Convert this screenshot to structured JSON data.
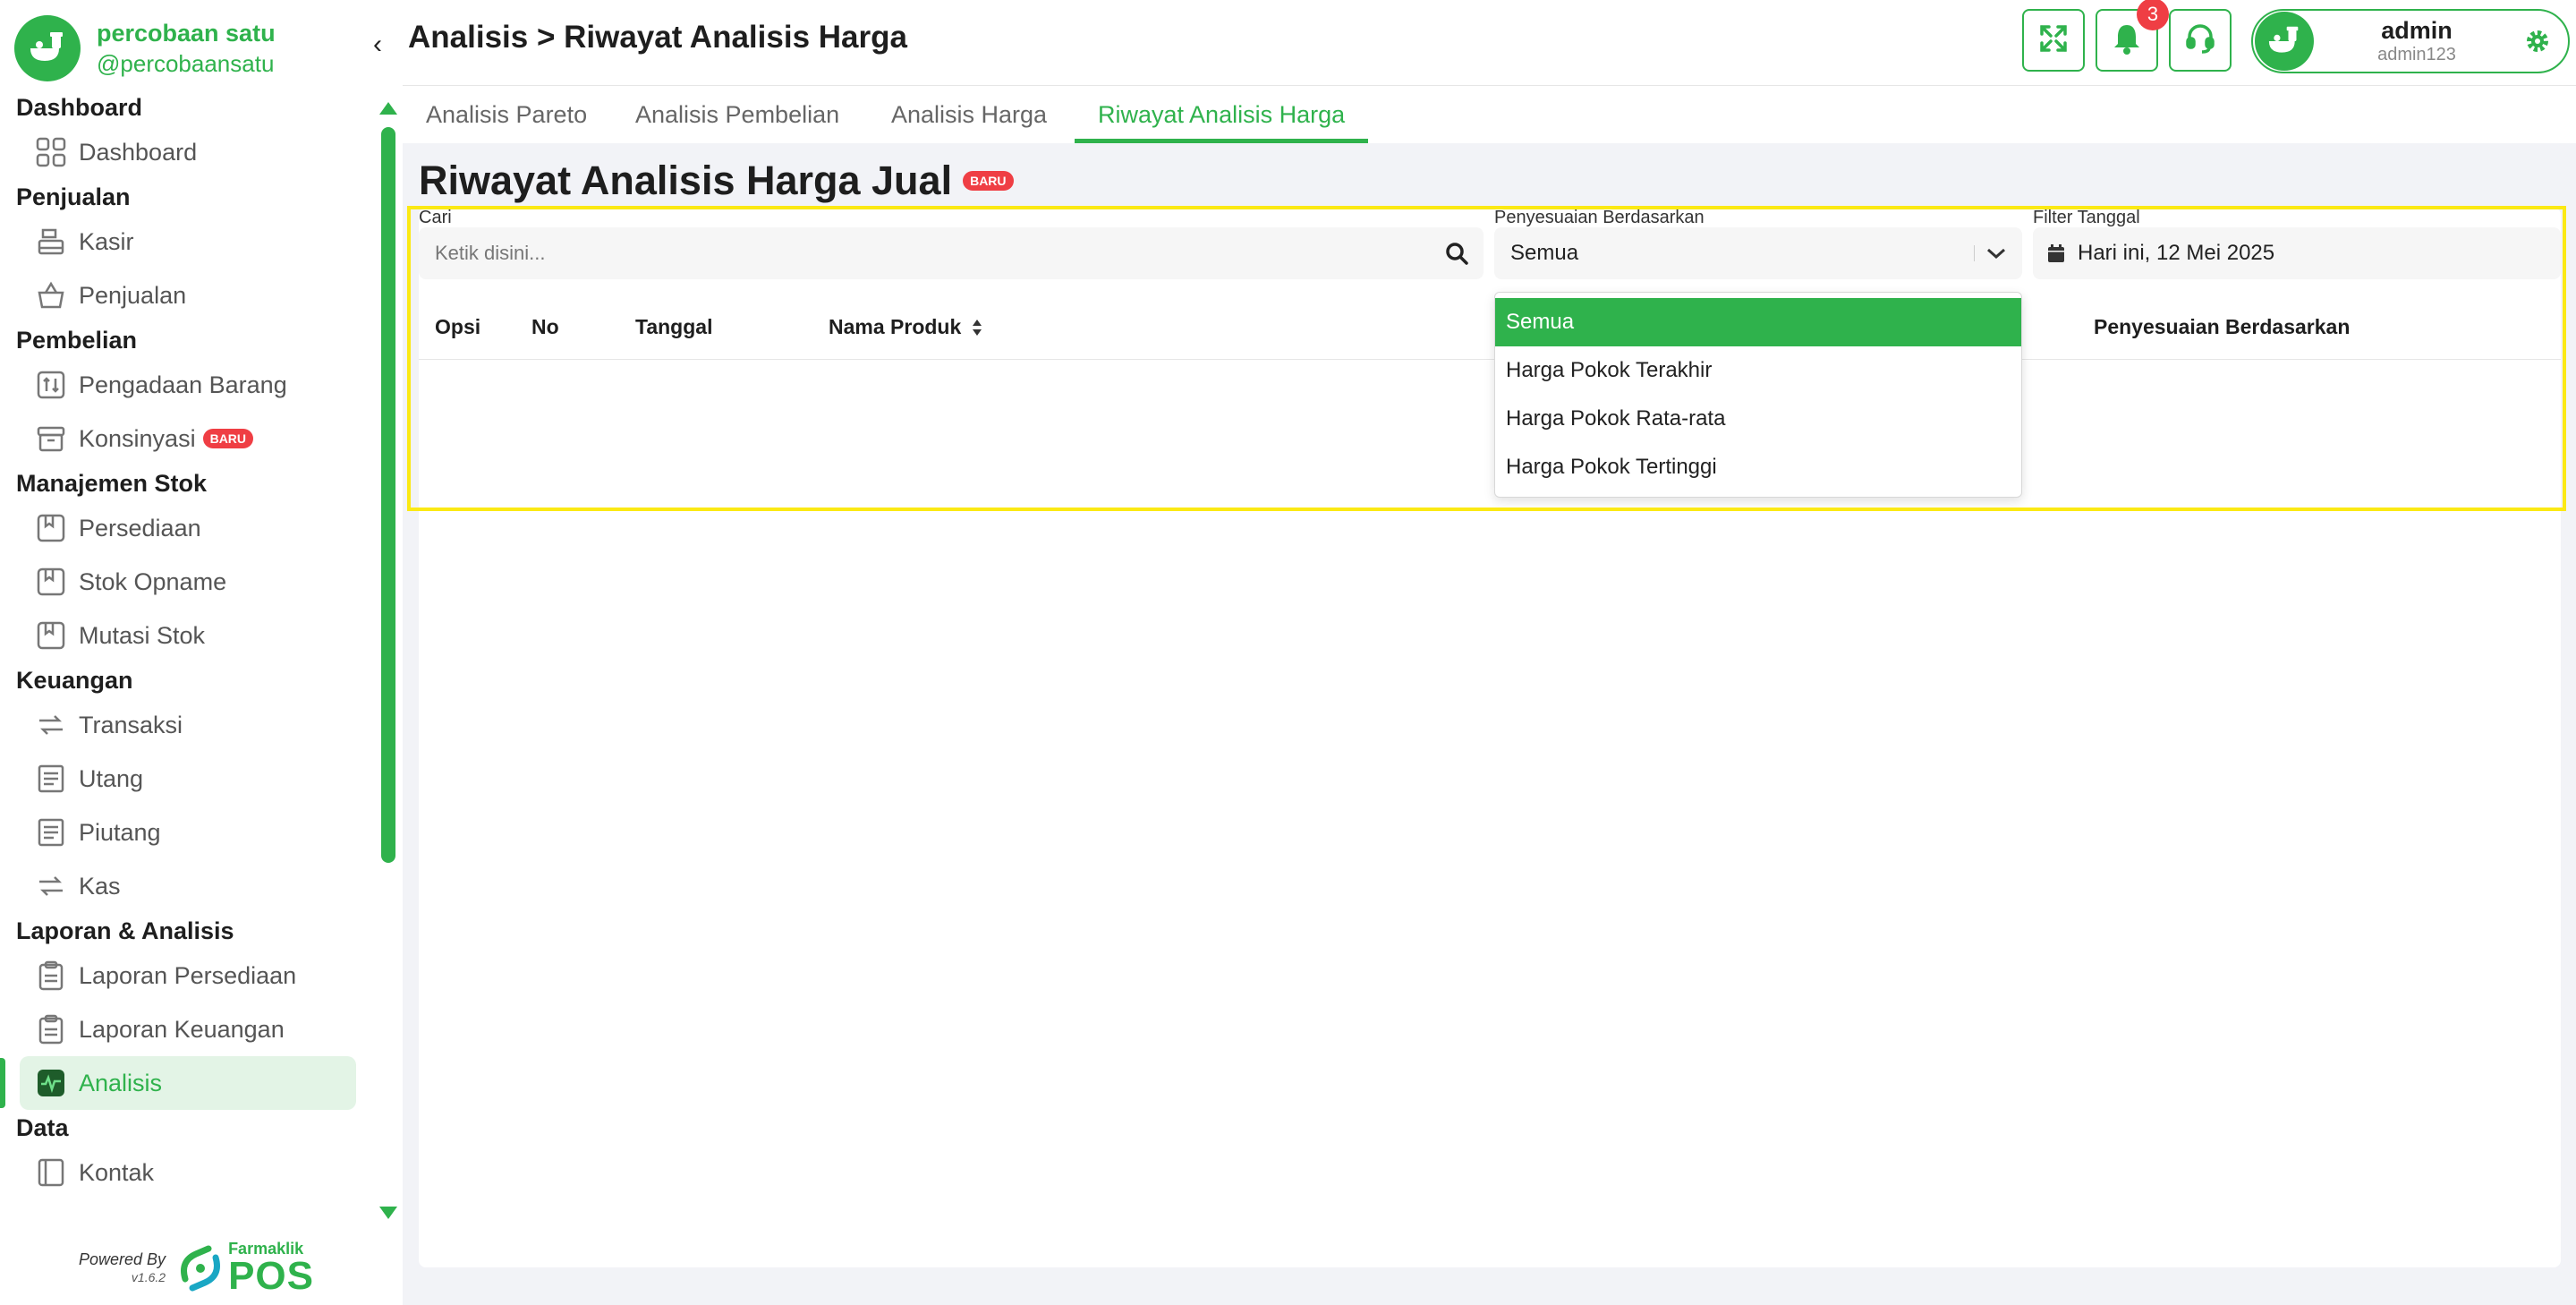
{
  "brand": {
    "name": "percobaan satu",
    "handle": "@percobaansatu"
  },
  "colors": {
    "accent": "#2fb24c",
    "badge": "#ef3e44",
    "highlight": "#fbe914"
  },
  "sidebar": {
    "sections": [
      {
        "title": "Dashboard",
        "items": [
          {
            "label": "Dashboard",
            "icon": "grid-icon"
          }
        ]
      },
      {
        "title": "Penjualan",
        "items": [
          {
            "label": "Kasir",
            "icon": "cash-register-icon"
          },
          {
            "label": "Penjualan",
            "icon": "basket-icon"
          }
        ]
      },
      {
        "title": "Pembelian",
        "items": [
          {
            "label": "Pengadaan Barang",
            "icon": "transfer-box-icon"
          },
          {
            "label": "Konsinyasi",
            "icon": "archive-icon",
            "badge": "BARU"
          }
        ]
      },
      {
        "title": "Manajemen Stok",
        "items": [
          {
            "label": "Persediaan",
            "icon": "bookmark-box-icon"
          },
          {
            "label": "Stok Opname",
            "icon": "bookmark-box-icon"
          },
          {
            "label": "Mutasi Stok",
            "icon": "bookmark-box-icon"
          }
        ]
      },
      {
        "title": "Keuangan",
        "items": [
          {
            "label": "Transaksi",
            "icon": "exchange-icon"
          },
          {
            "label": "Utang",
            "icon": "receipt-icon"
          },
          {
            "label": "Piutang",
            "icon": "receipt-icon"
          },
          {
            "label": "Kas",
            "icon": "exchange-icon"
          }
        ]
      },
      {
        "title": "Laporan & Analisis",
        "items": [
          {
            "label": "Laporan Persediaan",
            "icon": "clipboard-icon"
          },
          {
            "label": "Laporan Keuangan",
            "icon": "clipboard-icon"
          },
          {
            "label": "Analisis",
            "icon": "pulse-icon",
            "active": true
          }
        ]
      },
      {
        "title": "Data",
        "items": [
          {
            "label": "Kontak",
            "icon": "contact-book-icon"
          }
        ]
      }
    ]
  },
  "footer": {
    "powered_by": "Powered By",
    "version": "v1.6.2",
    "brand_small": "Farmaklik",
    "brand_big": "POS"
  },
  "header": {
    "breadcrumb": "Analisis > Riwayat Analisis Harga",
    "notification_count": "3",
    "user": {
      "name": "admin",
      "login": "admin123"
    }
  },
  "tabs": [
    {
      "label": "Analisis Pareto",
      "active": false
    },
    {
      "label": "Analisis Pembelian",
      "active": false
    },
    {
      "label": "Analisis Harga",
      "active": false
    },
    {
      "label": "Riwayat Analisis Harga",
      "active": true
    }
  ],
  "page": {
    "title": "Riwayat Analisis Harga Jual",
    "badge": "BARU"
  },
  "filters": {
    "search": {
      "label": "Cari",
      "placeholder": "Ketik disini..."
    },
    "adjustment": {
      "label": "Penyesuaian Berdasarkan",
      "value": "Semua"
    },
    "date": {
      "label": "Filter Tanggal",
      "value": "Hari ini, 12 Mei 2025"
    }
  },
  "table": {
    "columns": [
      "Opsi",
      "No",
      "Tanggal",
      "Nama Produk",
      "Penyesuaian Berdasarkan"
    ],
    "rows": []
  },
  "dropdown": {
    "options": [
      "Semua",
      "Harga Pokok Terakhir",
      "Harga Pokok Rata-rata",
      "Harga Pokok Tertinggi"
    ],
    "selected": "Semua"
  }
}
